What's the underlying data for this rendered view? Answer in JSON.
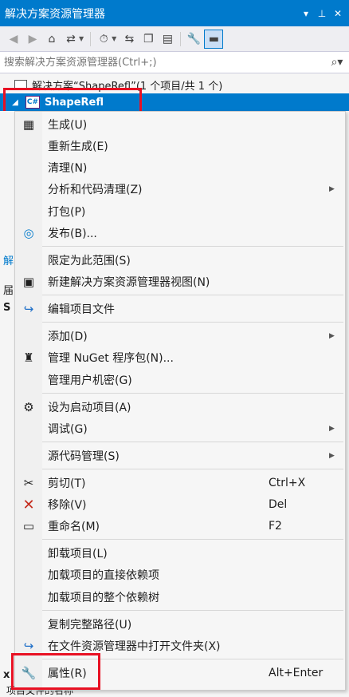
{
  "window": {
    "title": "解决方案资源管理器",
    "title_icons": [
      "▾",
      "ㅁ",
      "✕"
    ]
  },
  "toolbar": {
    "buttons": [
      "back-icon",
      "forward-icon",
      "home-icon",
      "switch-views-icon",
      "pending-changes-filter-icon",
      "sync-icon",
      "collapse-all-icon",
      "show-all-files-icon",
      "properties-wrench-icon",
      "preview-icon"
    ]
  },
  "search": {
    "placeholder": "搜索解决方案资源管理器(Ctrl+;)"
  },
  "tree": {
    "solution_label": "解决方案“ShapeRefl”(1 个项目/共 1 个)",
    "project_badge": "C#",
    "project_label": "ShapeRefl"
  },
  "background_peek": {
    "a": "解",
    "b": "届",
    "c": "S",
    "d": "x",
    "e": "项目文件的名称"
  },
  "menu": {
    "items": [
      {
        "label": "生成(U)",
        "shortcut": "",
        "icon": "build-icon"
      },
      {
        "label": "重新生成(E)",
        "shortcut": ""
      },
      {
        "label": "清理(N)",
        "shortcut": ""
      },
      {
        "label": "分析和代码清理(Z)",
        "shortcut": "",
        "submenu": true
      },
      {
        "label": "打包(P)",
        "shortcut": ""
      },
      {
        "label": "发布(B)...",
        "shortcut": "",
        "icon": "publish-globe-icon"
      },
      {
        "label": "限定为此范围(S)",
        "shortcut": ""
      },
      {
        "label": "新建解决方案资源管理器视图(N)",
        "shortcut": "",
        "icon": "new-view-icon"
      },
      {
        "label": "编辑项目文件",
        "shortcut": "",
        "icon": "edit-arrow-icon"
      },
      {
        "label": "添加(D)",
        "shortcut": "",
        "submenu": true
      },
      {
        "label": "管理 NuGet 程序包(N)...",
        "shortcut": "",
        "icon": "nuget-icon"
      },
      {
        "label": "管理用户机密(G)",
        "shortcut": ""
      },
      {
        "label": "设为启动项目(A)",
        "shortcut": "",
        "icon": "gear-icon"
      },
      {
        "label": "调试(G)",
        "shortcut": "",
        "submenu": true
      },
      {
        "label": "源代码管理(S)",
        "shortcut": "",
        "submenu": true
      },
      {
        "label": "剪切(T)",
        "shortcut": "Ctrl+X",
        "icon": "scissors-icon"
      },
      {
        "label": "移除(V)",
        "shortcut": "Del",
        "icon": "remove-x-icon"
      },
      {
        "label": "重命名(M)",
        "shortcut": "F2",
        "icon": "rename-icon"
      },
      {
        "label": "卸载项目(L)",
        "shortcut": ""
      },
      {
        "label": "加载项目的直接依赖项",
        "shortcut": ""
      },
      {
        "label": "加载项目的整个依赖树",
        "shortcut": ""
      },
      {
        "label": "复制完整路径(U)",
        "shortcut": ""
      },
      {
        "label": "在文件资源管理器中打开文件夹(X)",
        "shortcut": "",
        "icon": "open-folder-arrow-icon"
      },
      {
        "label": "属性(R)",
        "shortcut": "Alt+Enter",
        "icon": "wrench-icon"
      }
    ]
  },
  "colors": {
    "accent": "#007acc",
    "highlight_box": "#e81123",
    "remove_icon": "#c42b1c"
  }
}
